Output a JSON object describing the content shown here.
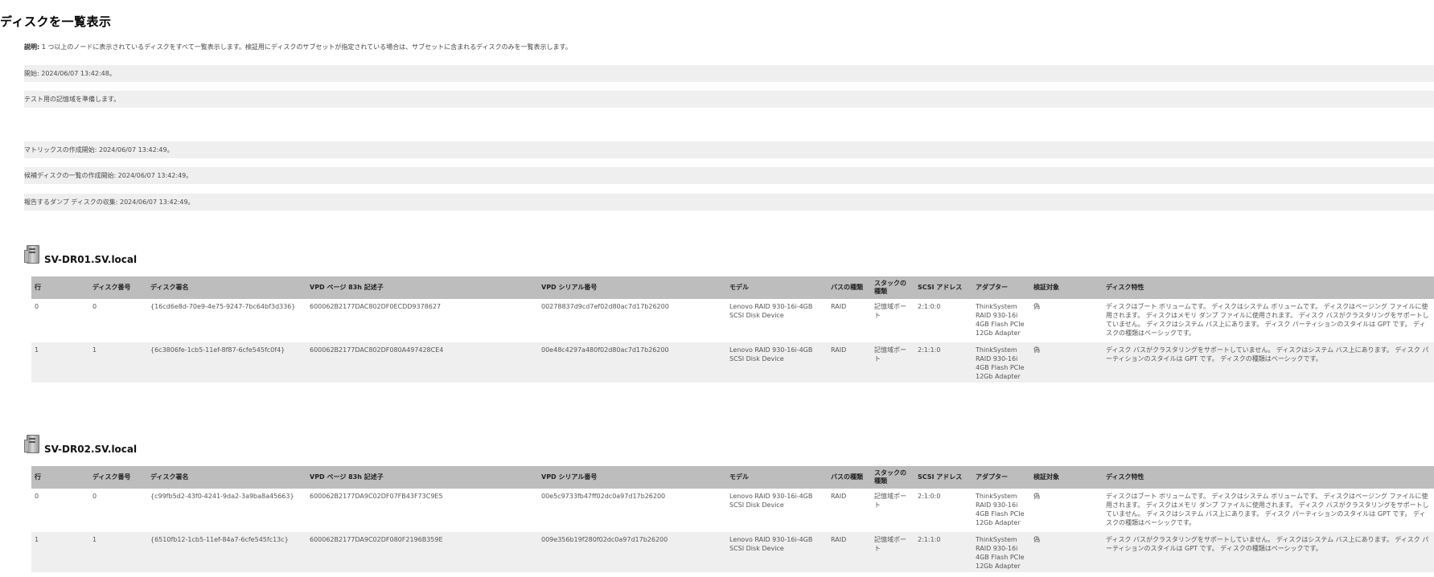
{
  "page": {
    "title": "ディスクを一覧表示",
    "description_label": "説明:",
    "description": " 1 つ以上のノードに表示されているディスクをすべて一覧表示します。検証用にディスクのサブセットが指定されている場合は、サブセットに含まれるディスクのみを一覧表示します。"
  },
  "log": [
    "開始: 2024/06/07 13:42:48。",
    "テスト用の記憶域を準備します。",
    "マトリックスの作成開始: 2024/06/07 13:42:49。",
    "候補ディスクの一覧の作成開始: 2024/06/07 13:42:49。",
    "報告するダンプ ディスクの収集: 2024/06/07 13:42:49。"
  ],
  "columns": [
    "行",
    "ディスク番号",
    "ディスク署名",
    "VPD ページ 83h 記述子",
    "VPD シリアル番号",
    "モデル",
    "バスの種類",
    "スタックの種類",
    "SCSI アドレス",
    "アダプター",
    "検証対象",
    "ディスク特性"
  ],
  "nodes": [
    {
      "name": "SV-DR01.SV.local",
      "rows": [
        {
          "row": "0",
          "disk_number": "0",
          "signature": "{16cd6e8d-70e9-4e75-9247-7bc64bf3d336}",
          "vpd83": "600062B2177DAC802DF0ECDD9378627",
          "serial": "00278837d9cd7ef02d80ac7d17b26200",
          "model": "Lenovo RAID 930-16i-4GB SCSI Disk Device",
          "bus": "RAID",
          "stack": "記憶域ポート",
          "scsi": "2:1:0:0",
          "adapter": "ThinkSystem RAID 930-16i 4GB Flash PCIe 12Gb Adapter",
          "validate": "偽",
          "traits": "ディスクはブート ボリュームです。 ディスクはシステム ボリュームです。 ディスクはページング ファイルに使用されます。 ディスクはメモリ ダンプ ファイルに使用されます。 ディスク バスがクラスタリングをサポートしていません。 ディスクはシステム バス上にあります。 ディスク パーティションのスタイルは GPT です。 ディスクの種類はベーシックです。"
        },
        {
          "row": "1",
          "disk_number": "1",
          "signature": "{6c3806fe-1cb5-11ef-8f87-6cfe545fc0f4}",
          "vpd83": "600062B2177DAC802DF080A497428CE4",
          "serial": "00e48c4297a480f02d80ac7d17b26200",
          "model": "Lenovo RAID 930-16i-4GB SCSI Disk Device",
          "bus": "RAID",
          "stack": "記憶域ポート",
          "scsi": "2:1:1:0",
          "adapter": "ThinkSystem RAID 930-16i 4GB Flash PCIe 12Gb Adapter",
          "validate": "偽",
          "traits": "ディスク バスがクラスタリングをサポートしていません。 ディスクはシステム バス上にあります。 ディスク パーティションのスタイルは GPT です。 ディスクの種類はベーシックです。"
        }
      ]
    },
    {
      "name": "SV-DR02.SV.local",
      "rows": [
        {
          "row": "0",
          "disk_number": "0",
          "signature": "{c99fb5d2-43f0-4241-9da2-3a9ba8a45663}",
          "vpd83": "600062B2177DA9C02DF07FB43F73C9E5",
          "serial": "00e5c9733fb47ff02dc0a97d17b26200",
          "model": "Lenovo RAID 930-16i-4GB SCSI Disk Device",
          "bus": "RAID",
          "stack": "記憶域ポート",
          "scsi": "2:1:0:0",
          "adapter": "ThinkSystem RAID 930-16i 4GB Flash PCIe 12Gb Adapter",
          "validate": "偽",
          "traits": "ディスクはブート ボリュームです。 ディスクはシステム ボリュームです。 ディスクはページング ファイルに使用されます。 ディスクはメモリ ダンプ ファイルに使用されます。 ディスク バスがクラスタリングをサポートしていません。 ディスクはシステム バス上にあります。 ディスク パーティションのスタイルは GPT です。 ディスクの種類はベーシックです。"
        },
        {
          "row": "1",
          "disk_number": "1",
          "signature": "{6510fb12-1cb5-11ef-84a7-6cfe545fc13c}",
          "vpd83": "600062B2177DA9C02DF080F2196B359E",
          "serial": "009e356b19f280f02dc0a97d17b26200",
          "model": "Lenovo RAID 930-16i-4GB SCSI Disk Device",
          "bus": "RAID",
          "stack": "記憶域ポート",
          "scsi": "2:1:1:0",
          "adapter": "ThinkSystem RAID 930-16i 4GB Flash PCIe 12Gb Adapter",
          "validate": "偽",
          "traits": "ディスク バスがクラスタリングをサポートしていません。 ディスクはシステム バス上にあります。 ディスク パーティションのスタイルは GPT です。 ディスクの種類はベーシックです。"
        }
      ]
    }
  ]
}
